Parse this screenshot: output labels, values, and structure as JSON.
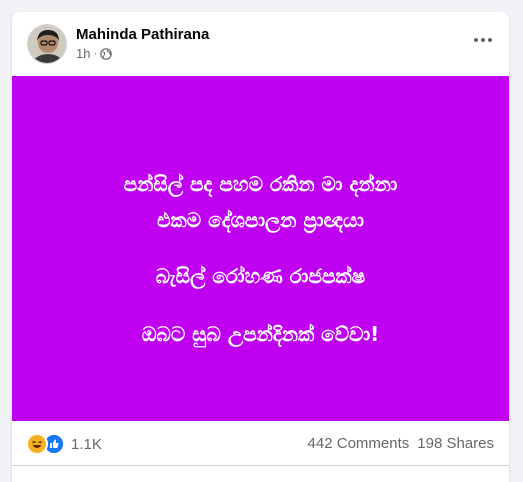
{
  "post": {
    "author_name": "Mahinda Pathirana",
    "timestamp": "1h",
    "separator": "·",
    "privacy_icon": "globe-icon",
    "more_icon": "more-options-icon"
  },
  "image_text": {
    "line1": "පන්සිල් පද පහම රකින මා දන්නා",
    "line2": "එකම දේශපාලන ප්‍රාඥයා",
    "line3": "බැසිල් රෝහණ රාජපක්ෂ",
    "line4": "ඔබට සුබ උපන්දිනක් වේවා!"
  },
  "reactions": {
    "types": [
      "haha",
      "like"
    ],
    "count": "1.1K"
  },
  "stats": {
    "comments": "442 Comments",
    "shares": "198 Shares"
  },
  "colors": {
    "image_background": "#c000f0",
    "like_blue": "#1877f2",
    "haha_yellow": "#f7b125"
  }
}
